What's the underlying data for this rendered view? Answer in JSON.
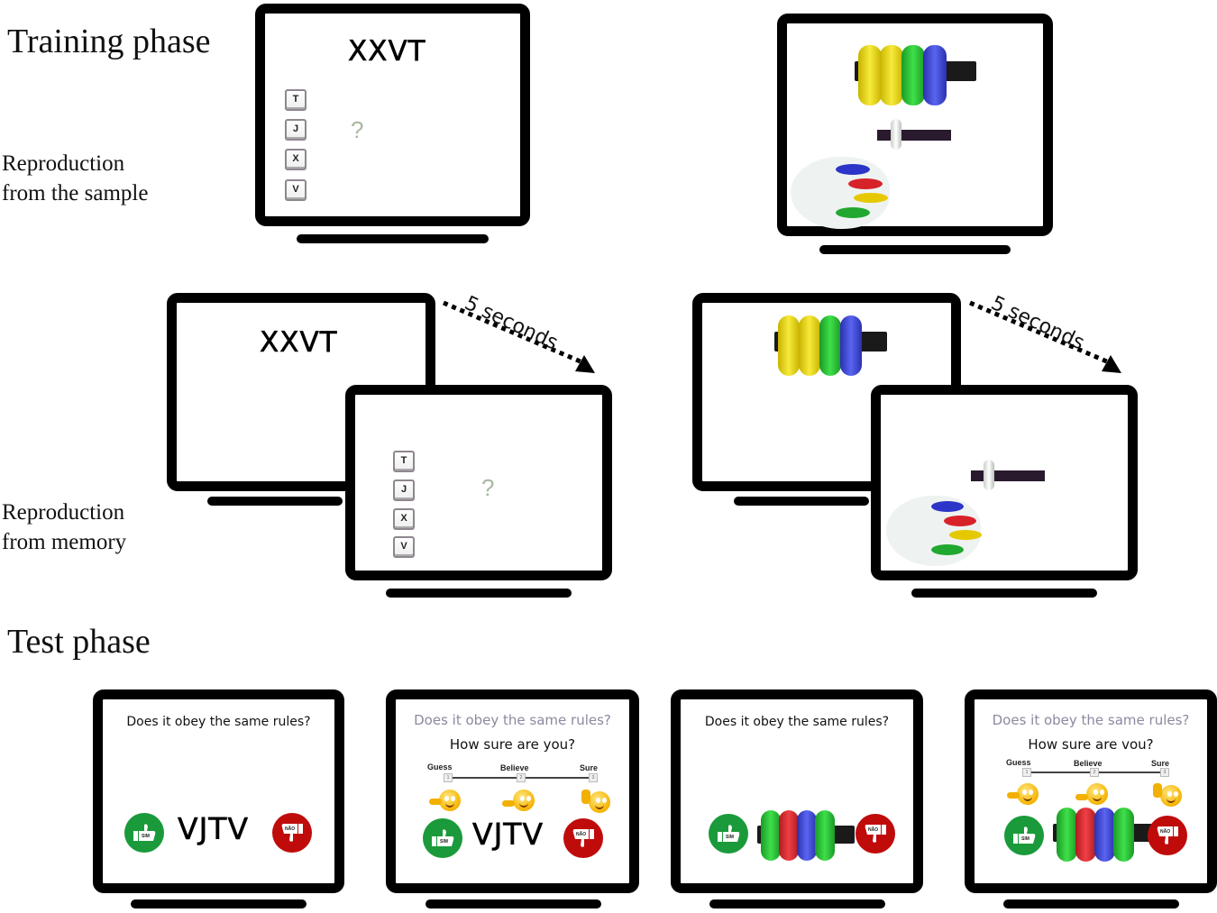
{
  "training": {
    "title": "Training phase",
    "sample_label_line1": "Reproduction",
    "sample_label_line2": "from the sample",
    "memory_label_line1": "Reproduction",
    "memory_label_line2": "from memory"
  },
  "test": {
    "title": "Test phase"
  },
  "letters_task": {
    "sample_sequence": "XXVT",
    "keys": [
      "T",
      "J",
      "X",
      "V"
    ],
    "question_mark": "?"
  },
  "beads_task": {
    "sample_beads": [
      "yellow",
      "yellow",
      "green",
      "blue"
    ],
    "palette_colors": [
      "blue",
      "red",
      "yellow",
      "green"
    ]
  },
  "delay": {
    "label": "5 seconds"
  },
  "test_screens": [
    {
      "question": "Does it obey the same rules?",
      "stimulus_text": "VJTV",
      "yes_label": "SIM",
      "no_label": "NÃO"
    },
    {
      "question": "Does it obey the same rules?",
      "confidence_question": "How sure are you?",
      "scale": [
        {
          "label": "Guess",
          "value": "1"
        },
        {
          "label": "Believe",
          "value": "2"
        },
        {
          "label": "Sure",
          "value": "3"
        }
      ],
      "stimulus_text": "VJTV",
      "yes_label": "SIM",
      "no_label": "NÃO"
    },
    {
      "question": "Does it obey the same rules?",
      "stimulus_beads": [
        "green",
        "red",
        "blue",
        "green"
      ],
      "yes_label": "SIM",
      "no_label": "NÃO"
    },
    {
      "question": "Does it obey the same rules?",
      "confidence_question": "How sure are vou?",
      "scale": [
        {
          "label": "Guess",
          "value": "1"
        },
        {
          "label": "Believe",
          "value": "2"
        },
        {
          "label": "Sure",
          "value": "3"
        }
      ],
      "stimulus_beads": [
        "green",
        "red",
        "blue",
        "green"
      ],
      "yes_label": "SIM",
      "no_label": "NÃO"
    }
  ],
  "colors": {
    "yellow": "#f2e020",
    "green": "#2fc43a",
    "blue": "#3b45d8",
    "red": "#e0262a",
    "yes_button": "#1a9a3a",
    "no_button": "#c00b0b"
  }
}
